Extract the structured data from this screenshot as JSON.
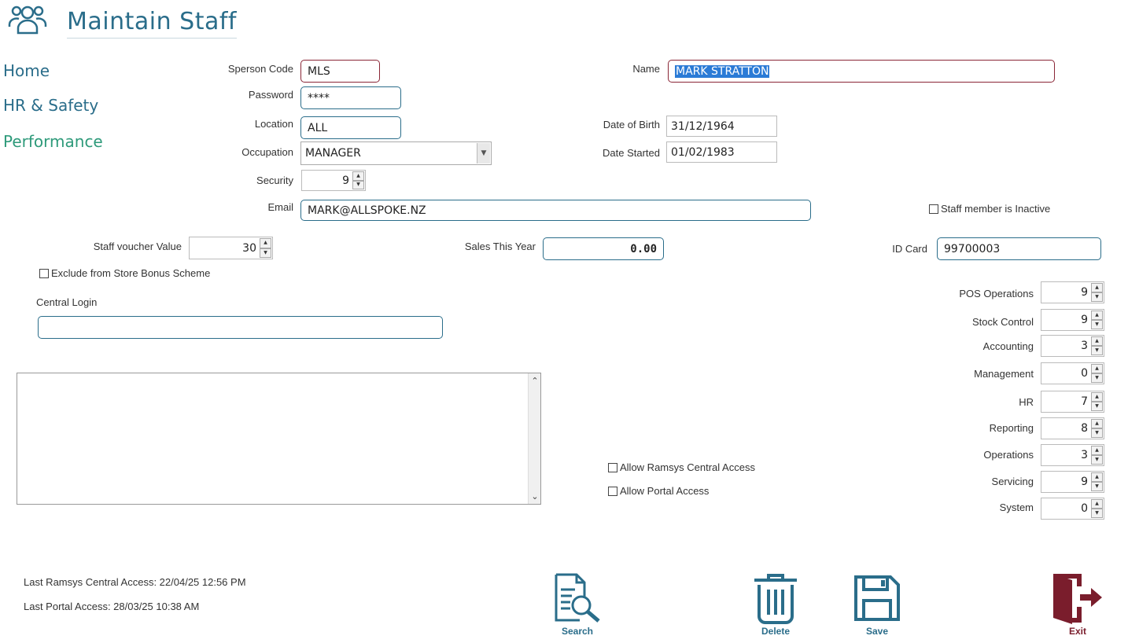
{
  "header": {
    "title": "Maintain Staff",
    "icon": "staff-group-icon"
  },
  "nav": {
    "items": [
      {
        "label": "Home"
      },
      {
        "label": "HR & Safety"
      },
      {
        "label": "Performance"
      }
    ]
  },
  "form": {
    "sperson_code": {
      "label": "Sperson Code",
      "value": "MLS"
    },
    "password": {
      "label": "Password",
      "value": "****"
    },
    "location": {
      "label": "Location",
      "value": "ALL"
    },
    "occupation": {
      "label": "Occupation",
      "value": "MANAGER"
    },
    "security": {
      "label": "Security",
      "value": "9"
    },
    "email": {
      "label": "Email",
      "value": "MARK@ALLSPOKE.NZ"
    },
    "name": {
      "label": "Name",
      "value": "MARK STRATTON"
    },
    "dob": {
      "label": "Date of Birth",
      "value": "31/12/1964"
    },
    "date_started": {
      "label": "Date Started",
      "value": "01/02/1983"
    },
    "inactive": {
      "label": "Staff member is Inactive",
      "checked": false
    },
    "voucher": {
      "label": "Staff voucher Value",
      "value": "30"
    },
    "sales": {
      "label": "Sales This Year",
      "value": "0.00"
    },
    "id_card": {
      "label": "ID Card",
      "value": "99700003"
    },
    "exclude_bonus": {
      "label": "Exclude from Store Bonus Scheme",
      "checked": false
    },
    "central_login": {
      "label": "Central Login",
      "value": ""
    },
    "allow_central": {
      "label": "Allow Ramsys Central Access",
      "checked": false
    },
    "allow_portal": {
      "label": "Allow Portal Access",
      "checked": false
    }
  },
  "permissions": [
    {
      "label": "POS Operations",
      "value": "9"
    },
    {
      "label": "Stock Control",
      "value": "9"
    },
    {
      "label": "Accounting",
      "value": "3"
    },
    {
      "label": "Management",
      "value": "0"
    },
    {
      "label": "HR",
      "value": "7"
    },
    {
      "label": "Reporting",
      "value": "8"
    },
    {
      "label": "Operations",
      "value": "3"
    },
    {
      "label": "Servicing",
      "value": "9"
    },
    {
      "label": "System",
      "value": "0"
    }
  ],
  "footer": {
    "last_central": "Last Ramsys Central Access: 22/04/25 12:56 PM",
    "last_portal": "Last Portal Access: 28/03/25 10:38 AM"
  },
  "toolbar": {
    "search": "Search",
    "delete": "Delete",
    "save": "Save",
    "exit": "Exit"
  },
  "colors": {
    "accent": "#2a6d8a",
    "nav_active": "#2e9a7a",
    "required_border": "#8a2636",
    "exit": "#7a1d2c"
  }
}
